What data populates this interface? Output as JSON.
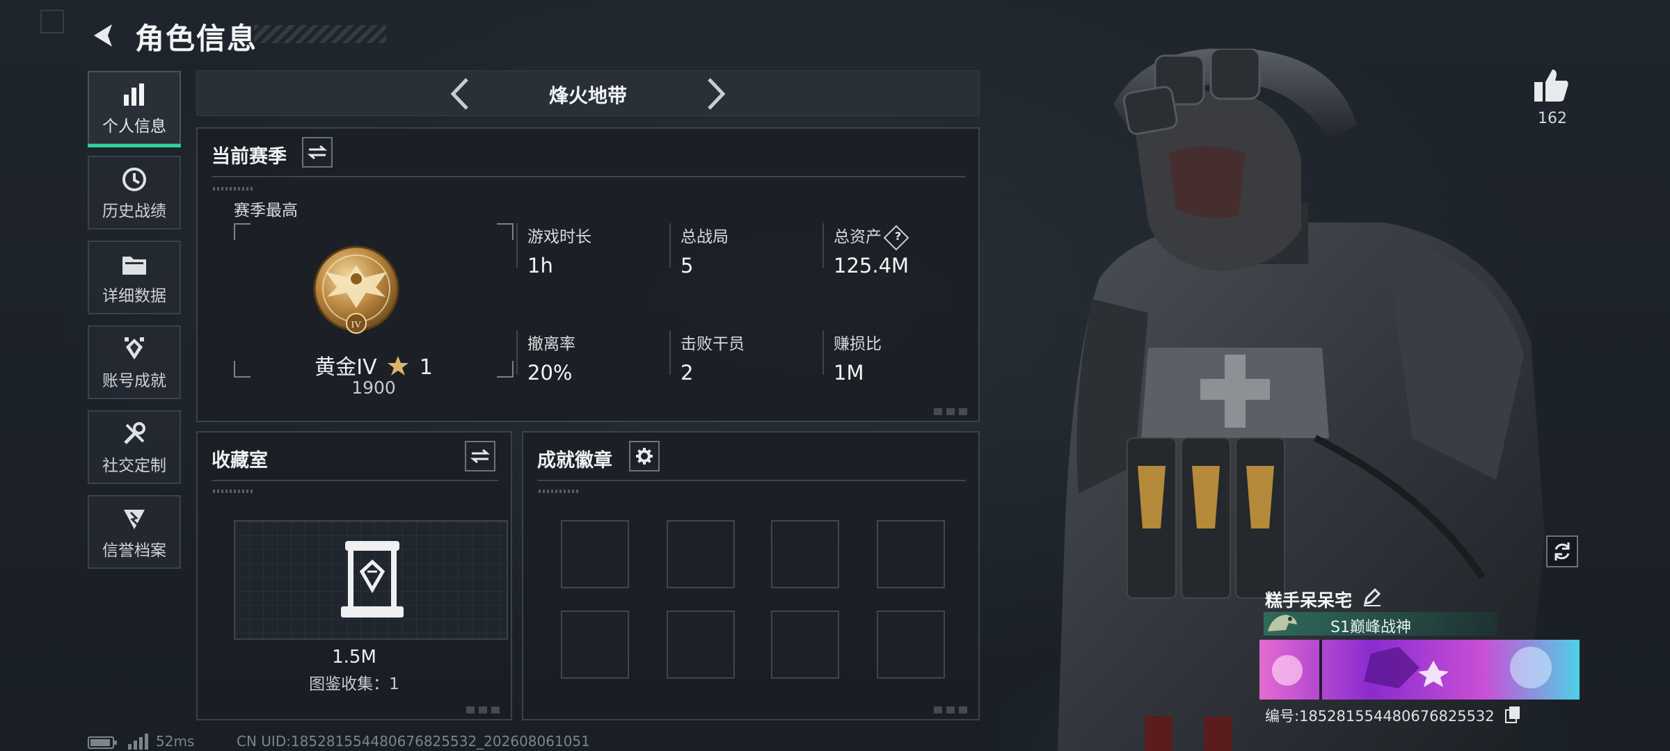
{
  "header": {
    "title": "角色信息"
  },
  "sidebar": {
    "items": [
      {
        "label": "个人信息",
        "icon": "bar-chart-icon",
        "active": true
      },
      {
        "label": "历史战绩",
        "icon": "history-clock-icon",
        "active": false
      },
      {
        "label": "详细数据",
        "icon": "folder-icon",
        "active": false
      },
      {
        "label": "账号成就",
        "icon": "achievement-badge-icon",
        "active": false
      },
      {
        "label": "社交定制",
        "icon": "tools-icon",
        "active": false
      },
      {
        "label": "信誉档案",
        "icon": "reputation-shield-icon",
        "active": false
      }
    ]
  },
  "mode": {
    "name": "烽火地带"
  },
  "season": {
    "title": "当前赛季",
    "subtitle": "赛季最高",
    "rank_name": "黄金IV",
    "rank_stars": "1",
    "rank_score": "1900",
    "stats": [
      {
        "label": "游戏时长",
        "value": "1h"
      },
      {
        "label": "总战局",
        "value": "5"
      },
      {
        "label": "总资产",
        "value": "125.4M",
        "help": "?"
      },
      {
        "label": "撤离率",
        "value": "20%"
      },
      {
        "label": "击败干员",
        "value": "2"
      },
      {
        "label": "赚损比",
        "value": "1M"
      }
    ]
  },
  "collection": {
    "title": "收藏室",
    "value": "1.5M",
    "subtitle": "图鉴收集：1"
  },
  "badges": {
    "title": "成就徽章",
    "slots": 8
  },
  "status_bar": {
    "ping": "52ms",
    "uid": "CN UID:185281554480676825532_202608061051"
  },
  "profile": {
    "likes": "162",
    "player_name": "糕手呆呆宅",
    "title_tag": "S1巅峰战神",
    "player_id": "编号:185281554480676825532"
  },
  "colors": {
    "accent": "#2fd19a",
    "background": "#1b2027",
    "panel_border": "#3a424b"
  }
}
